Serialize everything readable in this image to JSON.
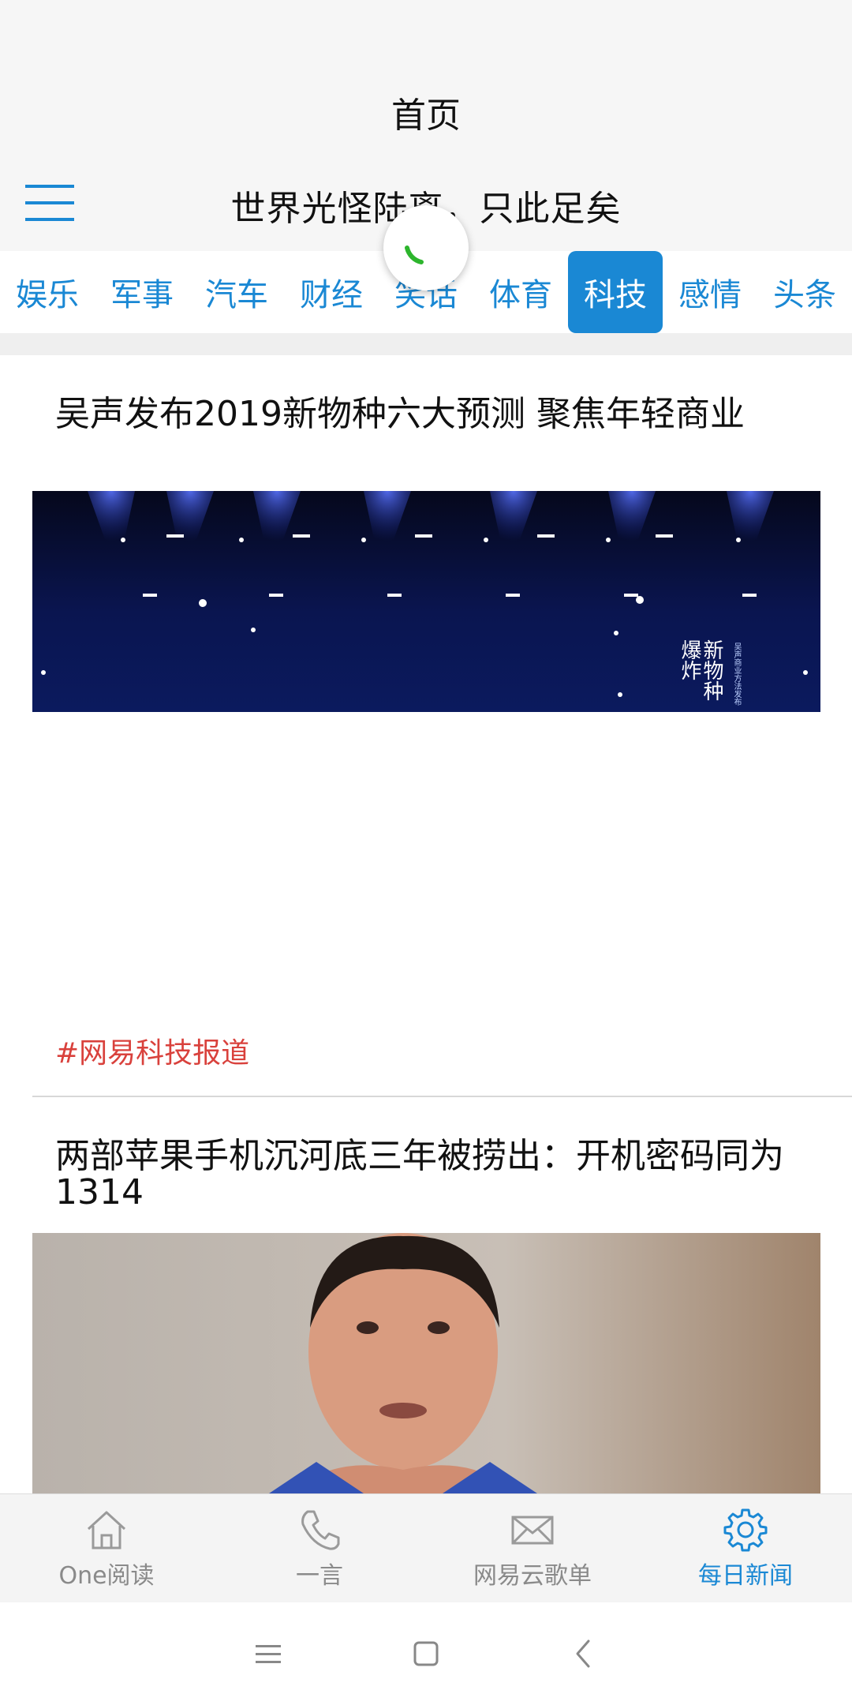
{
  "header": {
    "title": "首页",
    "subtitle": "世界光怪陆离，只此足矣"
  },
  "categories": [
    {
      "label": "娱乐",
      "active": false
    },
    {
      "label": "军事",
      "active": false
    },
    {
      "label": "汽车",
      "active": false
    },
    {
      "label": "财经",
      "active": false
    },
    {
      "label": "笑话",
      "active": false
    },
    {
      "label": "体育",
      "active": false
    },
    {
      "label": "科技",
      "active": true
    },
    {
      "label": "感情",
      "active": false
    },
    {
      "label": "头条",
      "active": false
    }
  ],
  "feed": [
    {
      "title": "吴声发布2019新物种六大预测 聚焦年轻商业",
      "image_caption": "新物种爆炸",
      "image_subcaption": "吴声商业方法发布",
      "source": "#网易科技报道"
    },
    {
      "title": "两部苹果手机沉河底三年被捞出：开机密码同为1314"
    }
  ],
  "bottom_nav": {
    "items": [
      {
        "label": "One阅读",
        "icon": "home-icon",
        "active": false
      },
      {
        "label": "一言",
        "icon": "phone-icon",
        "active": false
      },
      {
        "label": "网易云歌单",
        "icon": "mail-icon",
        "active": false
      },
      {
        "label": "每日新闻",
        "icon": "gear-icon",
        "active": true
      }
    ]
  },
  "colors": {
    "accent": "#1a88d4",
    "source_red": "#d9413c",
    "spinner_green": "#2db52d"
  }
}
